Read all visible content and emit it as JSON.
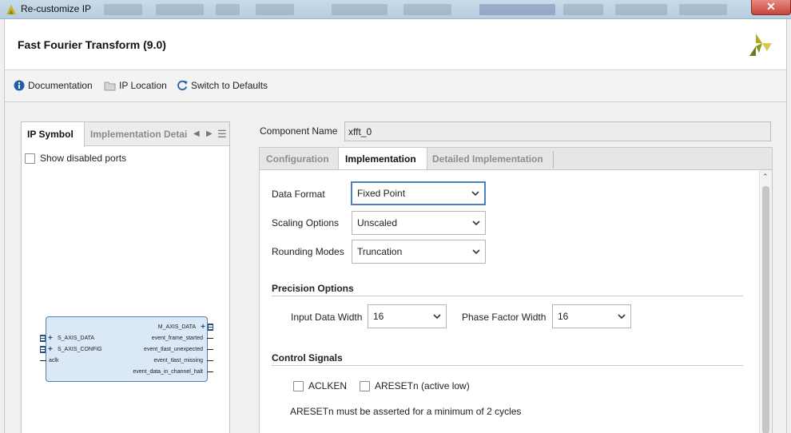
{
  "window": {
    "title": "Re-customize IP"
  },
  "header": {
    "heading": "Fast Fourier Transform (9.0)"
  },
  "toolbar": {
    "documentation": "Documentation",
    "ip_location": "IP Location",
    "switch_defaults": "Switch to Defaults"
  },
  "left_panel": {
    "tabs": [
      "IP Symbol",
      "Implementation Detai"
    ],
    "show_disabled_ports": "Show disabled ports",
    "ip_symbol": {
      "left_ports": [
        "S_AXIS_DATA",
        "S_AXIS_CONFIG",
        "aclk"
      ],
      "right_ports": [
        "M_AXIS_DATA",
        "event_frame_started",
        "event_tlast_unexpected",
        "event_tlast_missing",
        "event_data_in_channel_halt"
      ]
    }
  },
  "component": {
    "label": "Component Name",
    "value": "xfft_0"
  },
  "tabs": [
    "Configuration",
    "Implementation",
    "Detailed Implementation"
  ],
  "implementation": {
    "data_format": {
      "label": "Data Format",
      "value": "Fixed Point"
    },
    "scaling_options": {
      "label": "Scaling Options",
      "value": "Unscaled"
    },
    "rounding_modes": {
      "label": "Rounding Modes",
      "value": "Truncation"
    },
    "precision": {
      "title": "Precision Options",
      "input_width_label": "Input Data Width",
      "input_width_value": "16",
      "phase_width_label": "Phase Factor Width",
      "phase_width_value": "16"
    },
    "control": {
      "title": "Control Signals",
      "aclken": "ACLKEN",
      "aresetn": "ARESETn (active low)",
      "note": "ARESETn must be asserted for a minimum of 2 cycles"
    }
  },
  "colors": {
    "accent": "#4d7fc4",
    "brand_green": "#8a9a1a",
    "info_blue": "#1f5fa8"
  }
}
